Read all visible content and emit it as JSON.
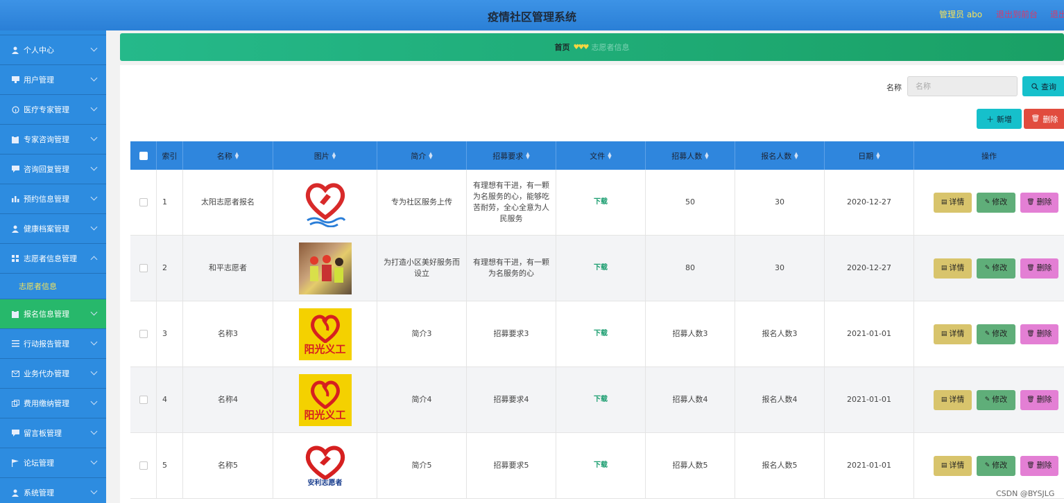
{
  "header": {
    "title": "疫情社区管理系统",
    "user_label": "管理员 abo",
    "back_label": "退出到前台",
    "logout_label": "退出"
  },
  "sidebar": {
    "items": [
      {
        "label": "个人中心",
        "icon": "person-icon"
      },
      {
        "label": "用户管理",
        "icon": "monitor-icon"
      },
      {
        "label": "医疗专家管理",
        "icon": "info-icon"
      },
      {
        "label": "专家咨询管理",
        "icon": "clipboard-icon"
      },
      {
        "label": "咨询回复管理",
        "icon": "chat-icon"
      },
      {
        "label": "预约信息管理",
        "icon": "chart-icon"
      },
      {
        "label": "健康档案管理",
        "icon": "person-icon"
      },
      {
        "label": "志愿者信息管理",
        "icon": "grid-icon"
      },
      {
        "label": "报名信息管理",
        "icon": "clipboard-icon"
      },
      {
        "label": "行动报告管理",
        "icon": "list-icon"
      },
      {
        "label": "业务代办管理",
        "icon": "mail-icon"
      },
      {
        "label": "费用缴纳管理",
        "icon": "copy-icon"
      },
      {
        "label": "留言板管理",
        "icon": "chat-icon"
      },
      {
        "label": "论坛管理",
        "icon": "flag-icon"
      },
      {
        "label": "系统管理",
        "icon": "person-icon"
      }
    ],
    "submenu_label": "志愿者信息"
  },
  "breadcrumb": {
    "home": "首页",
    "current": "志愿者信息"
  },
  "search": {
    "label": "名称",
    "placeholder": "名称",
    "query_label": "查询"
  },
  "toolbar": {
    "add_label": "新增",
    "delete_label": "删除"
  },
  "table": {
    "headers": [
      "索引",
      "名称",
      "图片",
      "简介",
      "招募要求",
      "文件",
      "招募人数",
      "报名人数",
      "日期",
      "操作"
    ],
    "rows": [
      {
        "index": "1",
        "name": "太阳志愿者报名",
        "intro": "专为社区服务上传",
        "req": "有理想有干进，有一颗为名服务的心，能够吃苦耐劳，全心全意为人民服务",
        "file": "下载",
        "recruit": "50",
        "signup": "30",
        "date": "2020-12-27"
      },
      {
        "index": "2",
        "name": "和平志愿者",
        "intro": "为打造小区美好服务而设立",
        "req": "有理想有干进，有一颗为名服务的心",
        "file": "下载",
        "recruit": "80",
        "signup": "30",
        "date": "2020-12-27"
      },
      {
        "index": "3",
        "name": "名称3",
        "intro": "简介3",
        "req": "招募要求3",
        "file": "下载",
        "recruit": "招募人数3",
        "signup": "报名人数3",
        "date": "2021-01-01"
      },
      {
        "index": "4",
        "name": "名称4",
        "intro": "简介4",
        "req": "招募要求4",
        "file": "下载",
        "recruit": "招募人数4",
        "signup": "报名人数4",
        "date": "2021-01-01"
      },
      {
        "index": "5",
        "name": "名称5",
        "intro": "简介5",
        "req": "招募要求5",
        "file": "下载",
        "recruit": "招募人数5",
        "signup": "报名人数5",
        "date": "2021-01-01"
      }
    ],
    "actions": {
      "detail": "详情",
      "edit": "修改",
      "delete": "删除"
    },
    "logo_texts": {
      "row3": "阳光义工",
      "row4": "阳光义工",
      "row5": "安利志愿者"
    }
  },
  "watermark": "CSDN @BYSJLG"
}
